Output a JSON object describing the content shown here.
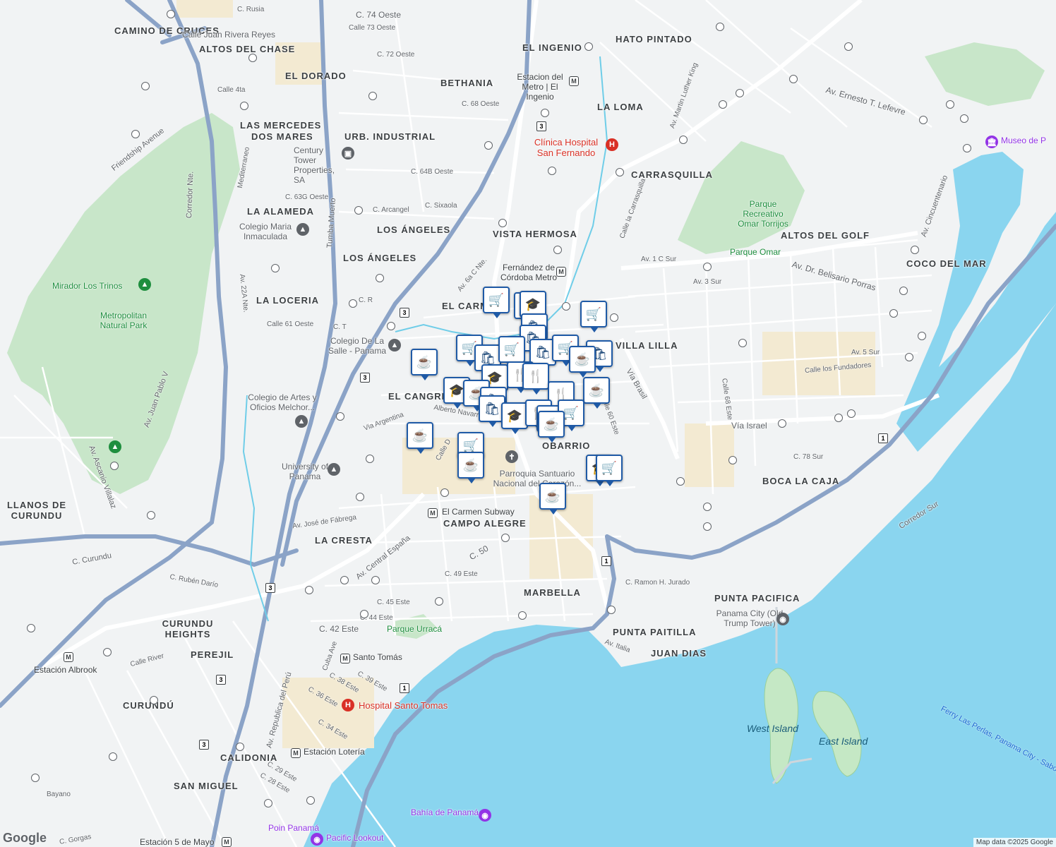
{
  "map": {
    "neighborhoods": [
      "CAMINO DE CRUCES",
      "ALTOS DEL CHASE",
      "EL DORADO",
      "LAS MERCEDES",
      "DOS MARES",
      "URB. INDUSTRIAL",
      "LA ALAMEDA",
      "LOS ÁNGELES",
      "LOS ÁNGELES",
      "LA LOCERIA",
      "EL CARMEN",
      "EL CANGREJO",
      "BETHANIA",
      "EL INGENIO",
      "HATO PINTADO",
      "LA LOMA",
      "CARRASQUILLA",
      "VISTA HERMOSA",
      "VILLA LILLA",
      "ALTOS DEL GOLF",
      "COCO DEL MAR",
      "OBARRIO",
      "CAMPO ALEGRE",
      "LA CRESTA",
      "BOCA LA CAJA",
      "MARBELLA",
      "PUNTA PACIFICA",
      "PUNTA PAITILLA",
      "JUAN DIAS",
      "LLANOS DE CURUNDU",
      "CURUNDU HEIGHTS",
      "PEREJIL",
      "CURUNDÚ",
      "CALIDONIA",
      "SAN MIGUEL"
    ],
    "streets": [
      "C. Rusia",
      "C. 74 Oeste",
      "Calle 73 Oeste",
      "Calle Juan Rivera Reyes",
      "Calle 4ta",
      "C. 72 Oeste",
      "C. 68 Oeste",
      "C. 64B Oeste",
      "C. 63G Oeste",
      "C. Arcangel",
      "C. Sixaola",
      "Friendship Avenue",
      "Corredor Nte.",
      "Tumba Muerto",
      "Av. 6a C Nte.",
      "Calle 61 Oeste",
      "C. R",
      "C. T",
      "Via Argentina",
      "Alberto Navarro",
      "Calle D",
      "Av. José de Fábrega",
      "Av. Central España",
      "C. 50",
      "C. 49 Este",
      "C. 45 Este",
      "C. 44 Este",
      "C. 42 Este",
      "C. 39 Este",
      "C. 38 Este",
      "C. 36 Este",
      "C. 34 Este",
      "Av. Juan Pablo V",
      "Av. Ascanio Villalaz",
      "C. Curundu",
      "C. Rubén Darío",
      "Calle River",
      "Av. Republica del Perú",
      "Cuba Ave",
      "Vía Brasil",
      "Vía Israel",
      "Av. Dr. Belisario Porras",
      "Av. 3 Sur",
      "Av. 1 C Sur",
      "Calle la Carrasquilla",
      "Av. Martin Luther King",
      "Av. Ernesto T. Lefevre",
      "Av. Cincuentenario",
      "Calle los Fundadores",
      "Av. 5 Sur",
      "C. 78 Sur",
      "Corredor Sur",
      "Calle 68 Este",
      "Calle 60 Este",
      "C. Ramon H. Jurado",
      "Av. Italia",
      "C. 29 Este",
      "C. 28 Este",
      "Bayano",
      "C. Gorgas",
      "Mediterraneo",
      "Av. 22A Nte."
    ],
    "pois": [
      {
        "name": "Century Tower Properties, SA",
        "kind": "building"
      },
      {
        "name": "Colegio Maria Inmaculada",
        "kind": "school"
      },
      {
        "name": "Colegio De La Salle - Panama",
        "kind": "school"
      },
      {
        "name": "Colegio de Artes y Oficios Melchor...",
        "kind": "school"
      },
      {
        "name": "University of Panama",
        "kind": "school"
      },
      {
        "name": "Parroquia Santuario Nacional del Corazón...",
        "kind": "church"
      },
      {
        "name": "Panama City (Old Trump Tower)",
        "kind": "landmark"
      },
      {
        "name": "Museo de P",
        "kind": "museum"
      },
      {
        "name": "Bahía de Panamá",
        "kind": "landmark"
      },
      {
        "name": "Pacific Lookout",
        "kind": "landmark"
      },
      {
        "name": "Poin Panamá",
        "kind": "landmark"
      }
    ],
    "hospitals": [
      "Clínica Hospital San Fernando",
      "Hospital Santo Tomas"
    ],
    "metro_stations": [
      "Estacion del Metro | El Ingenio",
      "Fernández de Córdoba Metro",
      "El Carmen Subway",
      "Santo Tomás",
      "Estación Lotería",
      "Estación Albrook",
      "Estación 5 de Mayo"
    ],
    "parks": [
      "Mirador Los Trinos",
      "Metropolitan Natural Park",
      "Parque Recreativo Omar Torrijos",
      "Parque Omar",
      "Parque Urracá"
    ],
    "islands": [
      "West Island",
      "East Island"
    ],
    "water_labels": [
      "Ferry Las Perlas, Panama City - Saboga"
    ],
    "route_shields": [
      "3",
      "1"
    ],
    "attribution": "Map data ©2025 Google",
    "logo": "Google"
  },
  "markers": [
    {
      "type": "grocery",
      "glyph": "🛒"
    },
    {
      "type": "school",
      "glyph": "🎓"
    },
    {
      "type": "shopping",
      "glyph": "🛍"
    },
    {
      "type": "cafe",
      "glyph": "☕"
    },
    {
      "type": "restaurant",
      "glyph": "🍴"
    }
  ]
}
